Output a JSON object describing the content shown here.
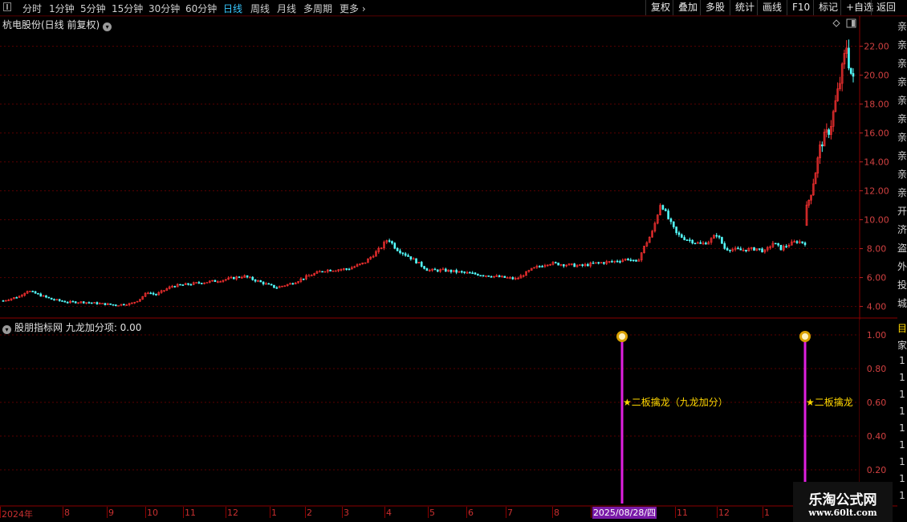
{
  "toolbar": {
    "left_items": [
      "分时",
      "1分钟",
      "5分钟",
      "15分钟",
      "30分钟",
      "60分钟",
      "日线",
      "周线",
      "月线",
      "多周期",
      "更多"
    ],
    "active": "日线",
    "right_items": [
      "复权",
      "叠加",
      "多股",
      "统计",
      "画线",
      "F10",
      "标记",
      "+自选",
      "返回"
    ]
  },
  "main_chart": {
    "title": "杭电股份(日线 前复权)",
    "y_ticks": [
      "22.00",
      "20.00",
      "18.00",
      "16.00",
      "14.00",
      "12.00",
      "10.00",
      "8.00",
      "6.00",
      "4.00"
    ]
  },
  "indicator": {
    "title": "股朋指标网 九龙加分项: 0.00",
    "y_ticks": [
      "1.00",
      "0.80",
      "0.60",
      "0.40",
      "0.20"
    ],
    "signals": [
      {
        "date": "2025/08/28",
        "label": "★二板擒龙（九龙加分）",
        "icon": "money-bag-icon"
      },
      {
        "date": "2025/10",
        "label": "★二板擒龙（",
        "icon": "money-bag-icon"
      }
    ]
  },
  "date_axis": {
    "labels": [
      "2024年",
      "8",
      "9",
      "10",
      "11",
      "12",
      "1",
      "2",
      "3",
      "4",
      "5",
      "6",
      "7",
      "8",
      "2025/08/28/四",
      "11",
      "12",
      "1"
    ],
    "highlighted": "2025/08/28/四"
  },
  "right_edge_text": [
    "亲",
    "亲",
    "亲",
    "亲",
    "亲",
    "亲",
    "亲",
    "亲",
    "亲",
    "亲",
    "开",
    "济",
    "盗",
    "外",
    "投",
    "城"
  ],
  "right_edge_lower": [
    "目",
    "家",
    "1",
    "1",
    "1",
    "1",
    "1",
    "1",
    "1",
    "1",
    "1",
    "1"
  ],
  "watermark": {
    "title": "乐淘公式网",
    "url": "www.60lt.com"
  },
  "colors": {
    "up": "#ff3232",
    "down": "#54ffff",
    "grid": "#5a0000",
    "signal": "#e020e0",
    "label": "#ffd700"
  },
  "chart_data": {
    "type": "candlestick",
    "title": "杭电股份(日线 前复权)",
    "ylim": [
      3.2,
      23.2
    ],
    "trend": [
      [
        0,
        4.4
      ],
      [
        0.02,
        4.7
      ],
      [
        0.03,
        5.1
      ],
      [
        0.04,
        4.9
      ],
      [
        0.06,
        4.5
      ],
      [
        0.08,
        4.3
      ],
      [
        0.1,
        4.3
      ],
      [
        0.12,
        4.2
      ],
      [
        0.14,
        4.1
      ],
      [
        0.16,
        4.2
      ],
      [
        0.17,
        4.5
      ],
      [
        0.18,
        5.0
      ],
      [
        0.19,
        4.8
      ],
      [
        0.21,
        5.4
      ],
      [
        0.24,
        5.6
      ],
      [
        0.27,
        5.8
      ],
      [
        0.3,
        6.1
      ],
      [
        0.32,
        5.7
      ],
      [
        0.34,
        5.3
      ],
      [
        0.36,
        5.6
      ],
      [
        0.38,
        6.1
      ],
      [
        0.4,
        6.5
      ],
      [
        0.43,
        6.6
      ],
      [
        0.45,
        7.0
      ],
      [
        0.47,
        8.0
      ],
      [
        0.48,
        8.7
      ],
      [
        0.49,
        8.0
      ],
      [
        0.51,
        7.3
      ],
      [
        0.53,
        6.5
      ],
      [
        0.55,
        6.5
      ],
      [
        0.58,
        6.3
      ],
      [
        0.61,
        6.1
      ],
      [
        0.64,
        5.9
      ],
      [
        0.66,
        6.6
      ],
      [
        0.68,
        7.0
      ],
      [
        0.7,
        6.9
      ],
      [
        0.72,
        6.8
      ],
      [
        0.74,
        7.0
      ],
      [
        0.76,
        7.1
      ],
      [
        0.78,
        7.3
      ],
      [
        0.79,
        7.0
      ],
      [
        0.8,
        8.2
      ],
      [
        0.81,
        9.2
      ],
      [
        0.82,
        11.2
      ],
      [
        0.83,
        10.0
      ],
      [
        0.84,
        9.0
      ],
      [
        0.85,
        8.7
      ],
      [
        0.87,
        8.3
      ],
      [
        0.88,
        8.5
      ],
      [
        0.89,
        9.0
      ],
      [
        0.9,
        8.0
      ],
      [
        0.92,
        7.9
      ],
      [
        0.94,
        8.0
      ],
      [
        0.95,
        7.8
      ],
      [
        0.96,
        8.4
      ],
      [
        0.97,
        8.0
      ],
      [
        0.98,
        8.3
      ],
      [
        0.99,
        8.5
      ],
      [
        1.0,
        8.4
      ]
    ],
    "rally": [
      [
        0,
        10.8
      ],
      [
        0.1,
        12.0
      ],
      [
        0.2,
        13.5
      ],
      [
        0.3,
        15.2
      ],
      [
        0.4,
        15.8
      ],
      [
        0.5,
        16.3
      ],
      [
        0.6,
        17.8
      ],
      [
        0.7,
        19.3
      ],
      [
        0.8,
        21.0
      ],
      [
        0.85,
        22.2
      ],
      [
        0.92,
        20.5
      ],
      [
        1.0,
        19.6
      ]
    ]
  }
}
